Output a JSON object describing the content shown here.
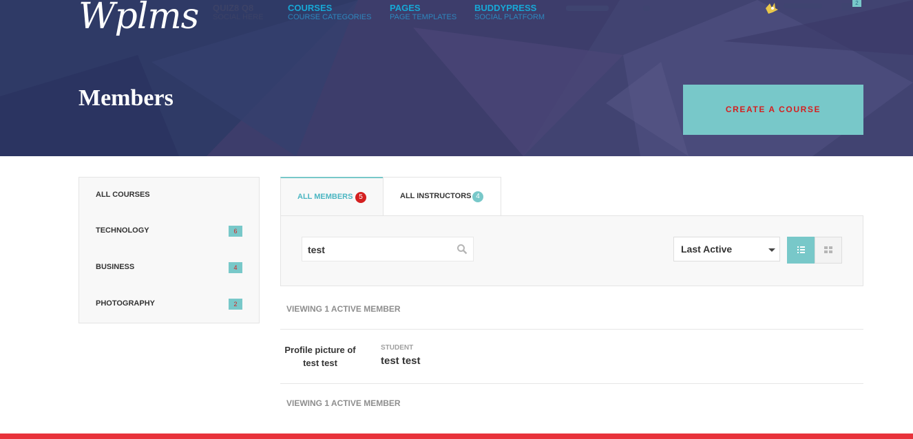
{
  "header": {
    "logo": "Wplms",
    "nav": [
      {
        "title": "QUIZ8 Q8",
        "subtitle": "SOCIAL HERE"
      },
      {
        "title": "COURSES",
        "subtitle": "COURSE CATEGORIES"
      },
      {
        "title": "PAGES",
        "subtitle": "PAGE TEMPLATES"
      },
      {
        "title": "BUDDYPRESS",
        "subtitle": "SOCIAL PLATFORM"
      }
    ],
    "cart_count": "2",
    "page_title": "Members",
    "create_course_label": "CREATE A COURSE"
  },
  "sidebar": {
    "items": [
      {
        "label": "ALL COURSES",
        "count": ""
      },
      {
        "label": "TECHNOLOGY",
        "count": "6"
      },
      {
        "label": "BUSINESS",
        "count": "4"
      },
      {
        "label": "PHOTOGRAPHY",
        "count": "2"
      }
    ]
  },
  "tabs": [
    {
      "label": "ALL MEMBERS",
      "count": "5"
    },
    {
      "label": "ALL INSTRUCTORS",
      "count": "4"
    }
  ],
  "filter": {
    "search_value": "test",
    "sort_value": "Last Active"
  },
  "results": {
    "count_text": "VIEWING 1 ACTIVE MEMBER",
    "members": [
      {
        "avatar_alt": "Profile picture of test test",
        "role": "STUDENT",
        "name": "test test"
      }
    ]
  },
  "colors": {
    "accent": "#78c8c9",
    "badge_red": "#d42020",
    "footer": "#e8323b"
  }
}
